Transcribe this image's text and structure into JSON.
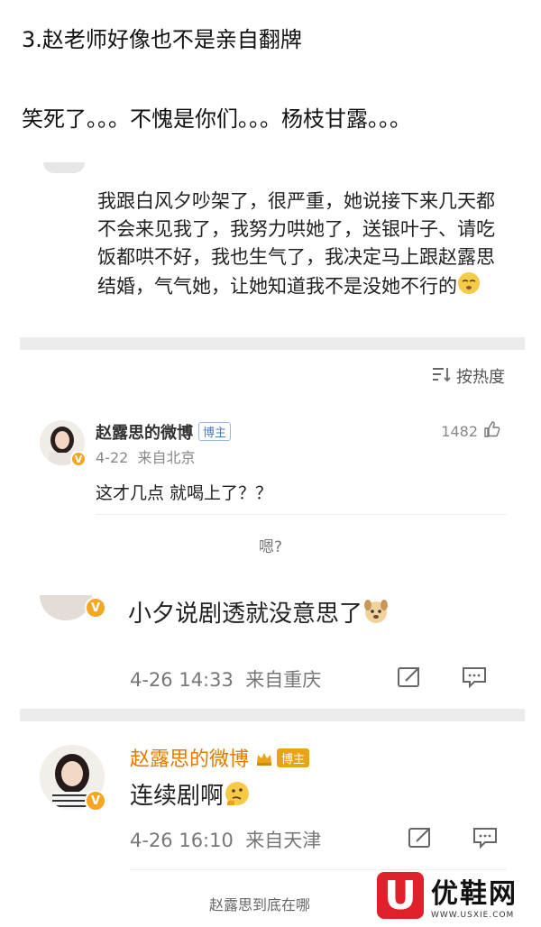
{
  "article": {
    "line1": "3.赵老师好像也不是亲自翻牌",
    "line2": "笑死了。。。不愧是你们。。。杨枝甘露。。。"
  },
  "post": {
    "text": "我跟白风夕吵架了，很严重，她说接下来几天都不会来见我了，我努力哄她了，送银叶子、请吃饭都哄不好，我也生气了，我决定马上跟赵露思结婚，气气她，让她知道我不是没她不行的"
  },
  "sort": {
    "label": "按热度",
    "icon": "sort-icon"
  },
  "comment1": {
    "name": "赵露思的微博",
    "tag": "博主",
    "likes": "1482",
    "date": "4-22",
    "location": "来自北京",
    "text": "这才几点 就喝上了？？"
  },
  "reply_hint": {
    "text": "嗯?"
  },
  "comment2": {
    "text": "小夕说剧透就没意思了",
    "date": "4-26 14:33",
    "location": "来自重庆"
  },
  "comment3": {
    "name": "赵露思的微博",
    "tag": "博主",
    "text": "连续剧啊",
    "date": "4-26 16:10",
    "location": "来自天津"
  },
  "footer": {
    "text": "赵露思到底在哪"
  },
  "watermark": {
    "brand": "优鞋网",
    "url": "WWW.USXIE.COM",
    "letter": "U"
  },
  "colors": {
    "accent": "#e07b00",
    "verified": "#f5a623",
    "brand": "#e0202a"
  }
}
